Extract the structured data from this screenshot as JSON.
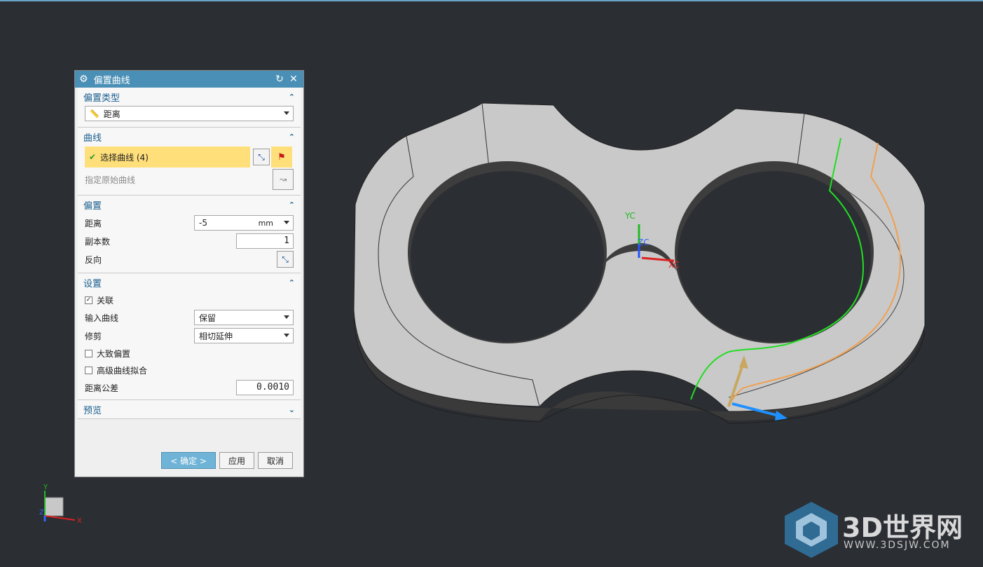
{
  "dialog": {
    "title": "偏置曲线",
    "sections": {
      "offset_type": {
        "header": "偏置类型",
        "value": "距离"
      },
      "curve": {
        "header": "曲线",
        "select_curve": "选择曲线 (4)",
        "original_curve": "指定原始曲线"
      },
      "offset": {
        "header": "偏置",
        "distance_label": "距离",
        "distance_value": "-5",
        "distance_unit": "mm",
        "copies_label": "副本数",
        "copies_value": "1",
        "reverse_label": "反向"
      },
      "settings": {
        "header": "设置",
        "associative_label": "关联",
        "input_curve_label": "输入曲线",
        "input_curve_value": "保留",
        "trim_label": "修剪",
        "trim_value": "相切延伸",
        "approx_offset_label": "大致偏置",
        "advanced_fit_label": "高级曲线拟合",
        "distance_tolerance_label": "距离公差",
        "distance_tolerance_value": "0.0010"
      },
      "preview": {
        "header": "预览"
      }
    },
    "buttons": {
      "ok": "< 确定 >",
      "apply": "应用",
      "cancel": "取消"
    }
  },
  "viewport": {
    "axes": {
      "yc": "YC",
      "zc": "ZC",
      "xc": "XC"
    },
    "triad": {
      "y": "Y",
      "z": "Z",
      "x": "X"
    }
  },
  "watermark": {
    "brand": "3D世界网",
    "url": "WWW.3DSJW.COM"
  },
  "colors": {
    "background": "#2b2e33",
    "title_bar": "#4a8fb5",
    "selection": "#ffdf7a",
    "green_curve": "#22dd22",
    "orange_curve": "#f0a050"
  }
}
